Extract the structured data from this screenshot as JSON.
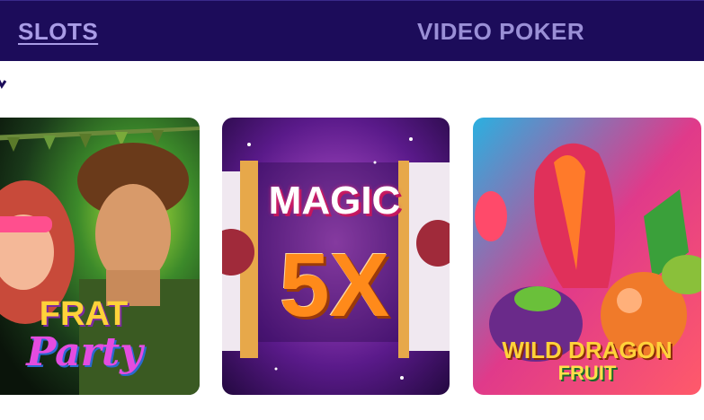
{
  "nav": {
    "tabs": [
      {
        "label": "SLOTS",
        "active": true
      },
      {
        "label": "VIDEO POKER",
        "active": false
      }
    ]
  },
  "games": [
    {
      "name": "Frat Party",
      "logo_line1": "FRAT",
      "logo_line2": "Party"
    },
    {
      "name": "Magic 5X",
      "logo_line1": "MAGIC",
      "logo_line2": "5X"
    },
    {
      "name": "Wild Dragon Fruit",
      "logo_line1": "WILD DRAGON",
      "logo_line2": "FRUIT"
    }
  ],
  "colors": {
    "nav_bg": "#1c0c5a",
    "tab_active": "#a99ce6",
    "tab_inactive": "#9a8fd6"
  }
}
